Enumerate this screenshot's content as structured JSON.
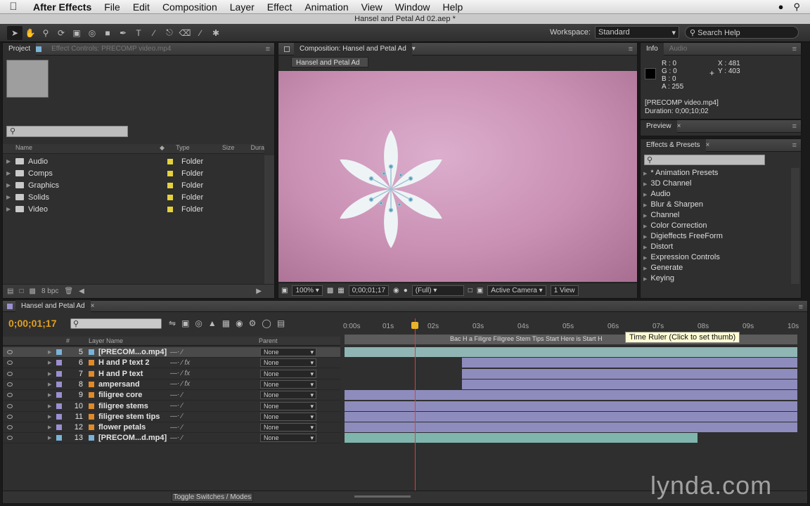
{
  "menubar": {
    "app": "After Effects",
    "items": [
      "File",
      "Edit",
      "Composition",
      "Layer",
      "Effect",
      "Animation",
      "View",
      "Window",
      "Help"
    ]
  },
  "window_title": "Hansel and Petal Ad 02.aep *",
  "toolbar": {
    "workspace_label": "Workspace:",
    "workspace_value": "Standard",
    "search_placeholder": "Search Help"
  },
  "project": {
    "tab": "Project",
    "tab2": "Effect Controls: PRECOMP video.mp4",
    "columns": {
      "name": "Name",
      "type": "Type",
      "size": "Size",
      "duration": "Dura"
    },
    "items": [
      {
        "name": "Audio",
        "type": "Folder"
      },
      {
        "name": "Comps",
        "type": "Folder"
      },
      {
        "name": "Graphics",
        "type": "Folder"
      },
      {
        "name": "Solids",
        "type": "Folder"
      },
      {
        "name": "Video",
        "type": "Folder"
      }
    ],
    "bpc": "8 bpc"
  },
  "composition": {
    "tab": "Composition: Hansel and Petal Ad",
    "flow": "Hansel and Petal Ad",
    "zoom": "100%",
    "time": "0;00;01;17",
    "resolution": "(Full)",
    "camera": "Active Camera",
    "view": "1 View"
  },
  "info": {
    "tab": "Info",
    "tab2": "Audio",
    "r": "R : 0",
    "g": "G : 0",
    "b": "B : 0",
    "a": "A : 255",
    "x": "X : 481",
    "y": "Y : 403",
    "source": "[PRECOMP video.mp4]",
    "duration": "Duration: 0;00;10;02"
  },
  "preview": {
    "tab": "Preview"
  },
  "effects": {
    "tab": "Effects & Presets",
    "items": [
      "* Animation Presets",
      "3D Channel",
      "Audio",
      "Blur & Sharpen",
      "Channel",
      "Color Correction",
      "Digieffects FreeForm",
      "Distort",
      "Expression Controls",
      "Generate",
      "Keying"
    ]
  },
  "timeline": {
    "tab": "Hansel and Petal Ad",
    "time": "0;00;01;17",
    "columns": {
      "num": "#",
      "layer_name": "Layer Name",
      "parent": "Parent"
    },
    "ruler_ticks": [
      "0:00s",
      "01s",
      "02s",
      "03s",
      "04s",
      "05s",
      "06s",
      "07s",
      "08s",
      "09s",
      "10s"
    ],
    "tooltip": "Time Ruler (Click to set thumb)",
    "marker_text": "Bac  H a  Filigre  Filigree Stem Tips Start Here  is Start H",
    "toggle": "Toggle Switches / Modes",
    "layers": [
      {
        "num": "5",
        "name": "[PRECOM...o.mp4]",
        "parent": "None",
        "color": "#7ab3d8",
        "type": "video",
        "fx": false,
        "start": 0.0,
        "end": 10.0,
        "bar_color": "#8fb6b4",
        "selected": true
      },
      {
        "num": "6",
        "name": "H and P text 2",
        "parent": "None",
        "color": "#9b8fd0",
        "type": "text",
        "fx": true,
        "start": 2.6,
        "end": 10.0,
        "bar_color": "#8e8cbd"
      },
      {
        "num": "7",
        "name": "H and P text",
        "parent": "None",
        "color": "#9b8fd0",
        "type": "text",
        "fx": true,
        "start": 2.6,
        "end": 10.0,
        "bar_color": "#8e8cbd"
      },
      {
        "num": "8",
        "name": "ampersand",
        "parent": "None",
        "color": "#9b8fd0",
        "type": "shape",
        "fx": true,
        "start": 2.6,
        "end": 10.0,
        "bar_color": "#8e8cbd"
      },
      {
        "num": "9",
        "name": "filigree core",
        "parent": "None",
        "color": "#9b8fd0",
        "type": "shape",
        "fx": false,
        "start": 0.0,
        "end": 10.0,
        "bar_color": "#8e8cbd"
      },
      {
        "num": "10",
        "name": "filigree stems",
        "parent": "None",
        "color": "#9b8fd0",
        "type": "shape",
        "fx": false,
        "start": 0.0,
        "end": 10.0,
        "bar_color": "#8e8cbd"
      },
      {
        "num": "11",
        "name": "filigree stem tips",
        "parent": "None",
        "color": "#9b8fd0",
        "type": "shape",
        "fx": false,
        "start": 0.0,
        "end": 10.0,
        "bar_color": "#8e8cbd"
      },
      {
        "num": "12",
        "name": "flower petals",
        "parent": "None",
        "color": "#9b8fd0",
        "type": "shape",
        "fx": false,
        "start": 0.0,
        "end": 10.0,
        "bar_color": "#8e8cbd"
      },
      {
        "num": "13",
        "name": "[PRECOM...d.mp4]",
        "parent": "None",
        "color": "#7ab3d8",
        "type": "video",
        "fx": false,
        "start": 0.0,
        "end": 7.8,
        "bar_color": "#7fb5ad"
      }
    ]
  },
  "watermark": "lynda.com"
}
